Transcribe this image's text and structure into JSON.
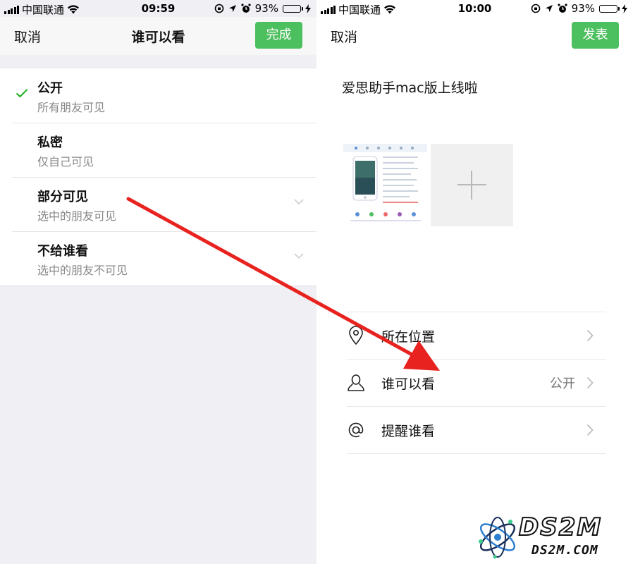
{
  "left": {
    "status": {
      "carrier": "中国联通",
      "time": "09:59",
      "battery": "93%",
      "battery_level": 0.93
    },
    "nav": {
      "cancel": "取消",
      "title": "谁可以看",
      "done": "完成"
    },
    "options": [
      {
        "title": "公开",
        "subtitle": "所有朋友可见",
        "selected": true
      },
      {
        "title": "私密",
        "subtitle": "仅自己可见"
      },
      {
        "title": "部分可见",
        "subtitle": "选中的朋友可见",
        "expandable": true
      },
      {
        "title": "不给谁看",
        "subtitle": "选中的朋友不可见",
        "expandable": true
      }
    ]
  },
  "right": {
    "status": {
      "carrier": "中国联通",
      "time": "10:00",
      "battery": "93%",
      "battery_level": 0.93
    },
    "nav": {
      "cancel": "取消",
      "post": "发表"
    },
    "post_text": "爱思助手mac版上线啦",
    "rows": [
      {
        "icon": "location-pin-icon",
        "label": "所在位置",
        "value": ""
      },
      {
        "icon": "person-icon",
        "label": "谁可以看",
        "value": "公开"
      },
      {
        "icon": "at-sign-icon",
        "label": "提醒谁看",
        "value": ""
      }
    ]
  },
  "watermark": {
    "brand": "DS2M",
    "domain": "DS2M.COM"
  },
  "colors": {
    "wechat_green": "#4cbf5e",
    "arrow_red": "#e8231f",
    "check_green": "#1aad19"
  }
}
